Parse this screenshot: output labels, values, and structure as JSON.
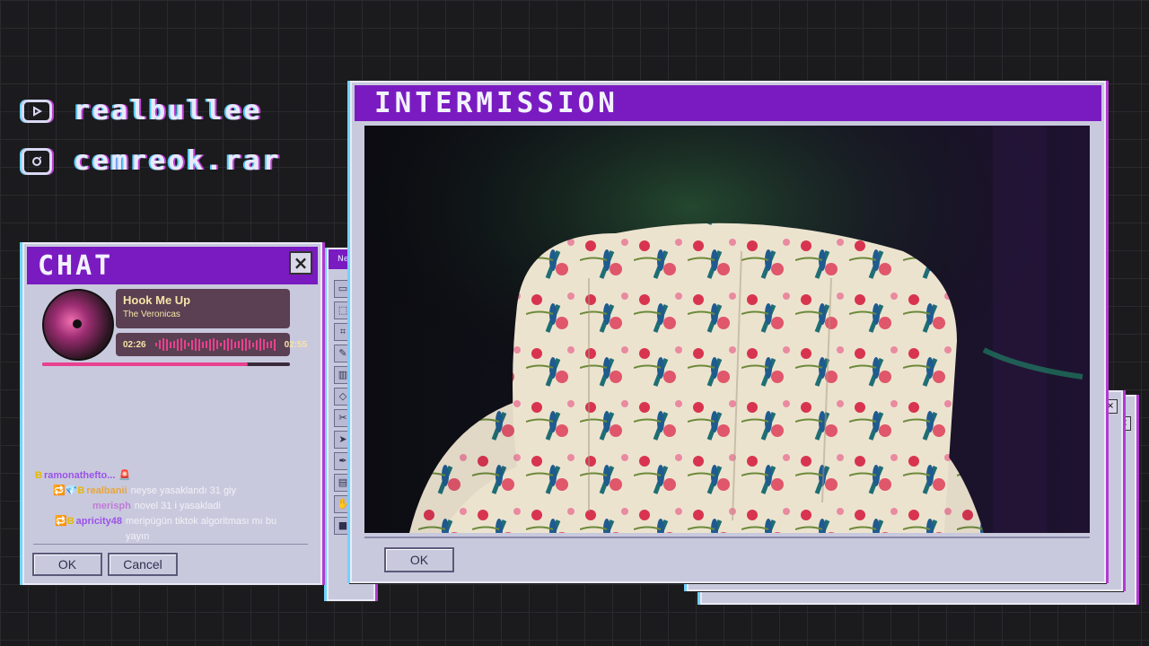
{
  "socials": [
    {
      "icon": "youtube-icon",
      "handle": "realbullee"
    },
    {
      "icon": "instagram-icon",
      "handle": "cemreok.rar"
    }
  ],
  "chat_window": {
    "title": "CHAT",
    "close_glyph": "×",
    "now_playing": {
      "title": "Hook Me Up",
      "artist": "The Veronicas",
      "elapsed": "02:26",
      "total": "02:55",
      "progress": 0.83
    },
    "messages": [
      {
        "badges": "B",
        "user": "ramonathefto...",
        "text": "🚨",
        "user_color": "#9a52e8"
      },
      {
        "badges": "🔁💎B",
        "user": "realbanii",
        "text": "neyse yasaklandı 31 giy",
        "user_color": "#e8a63a"
      },
      {
        "badges": "",
        "user": "merisph",
        "text": "novel 31 i yasakladi",
        "user_color": "#c07bd8"
      },
      {
        "badges": "🔁B",
        "user": "apricity48",
        "text": "meripügün tiktok algoritması mı bu yayın",
        "user_color": "#9a52e8"
      }
    ],
    "ok_label": "OK",
    "cancel_label": "Cancel"
  },
  "paint_window": {
    "title_fragment": "Ne",
    "tools": [
      "▭",
      "⬚",
      "⌗",
      "✎",
      "▥",
      "◇",
      "✂",
      "➤",
      "✒",
      "▤",
      "✋",
      "■"
    ]
  },
  "intermission_window": {
    "title": "INTERMISSION",
    "ok_label": "OK"
  },
  "colors": {
    "titlebar": "#7a1bc1",
    "window_bg": "#c9c9de",
    "accent_pink": "#e8418f",
    "card_bg": "#5a4052"
  }
}
